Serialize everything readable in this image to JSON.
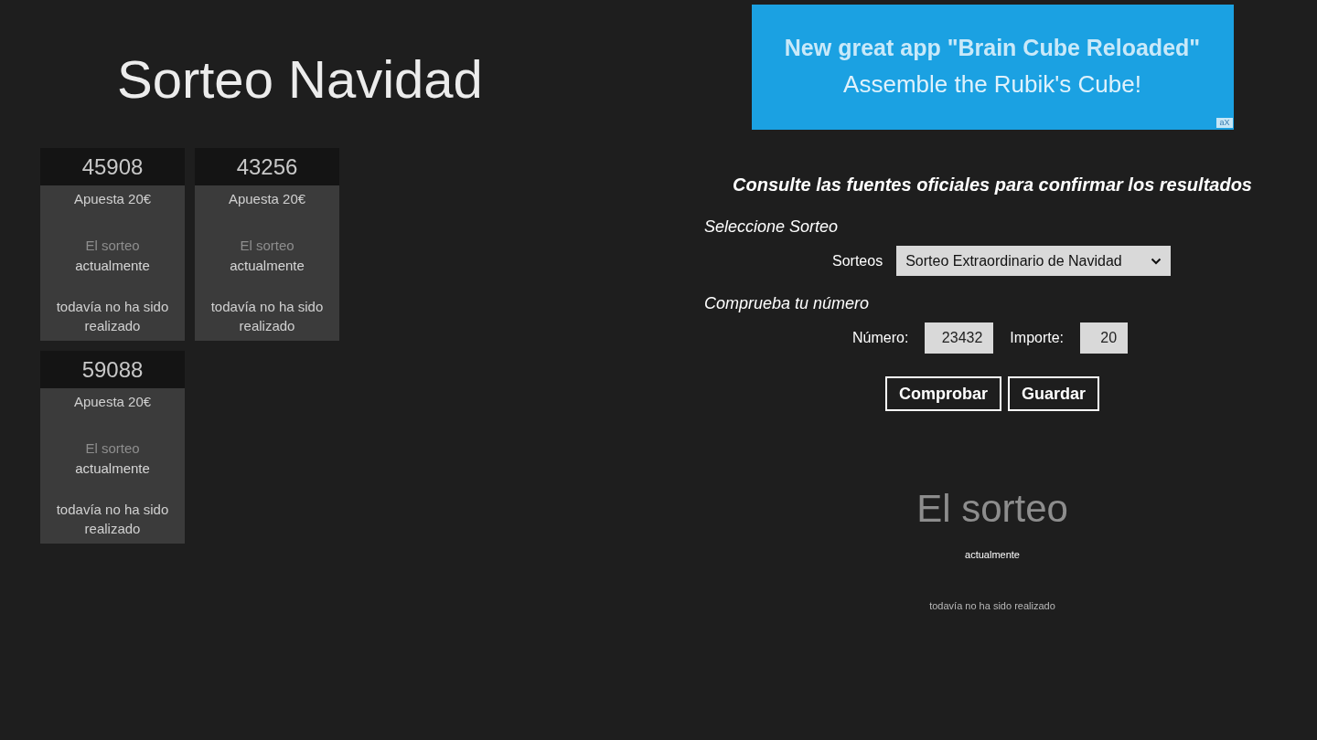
{
  "title": "Sorteo Navidad",
  "tickets": [
    {
      "number": "45908",
      "bet": "Apuesta 20€",
      "status": {
        "heading": "El sorteo",
        "detail": "actualmente",
        "note": "todavía no ha sido realizado"
      }
    },
    {
      "number": "43256",
      "bet": "Apuesta 20€",
      "status": {
        "heading": "El sorteo",
        "detail": "actualmente",
        "note": "todavía no ha sido realizado"
      }
    },
    {
      "number": "59088",
      "bet": "Apuesta 20€",
      "status": {
        "heading": "El sorteo",
        "detail": "actualmente",
        "note": "todavía no ha sido realizado"
      }
    }
  ],
  "ad": {
    "headline": "New great app \"Brain Cube Reloaded\"",
    "tagline": "Assemble the Rubik's Cube!",
    "mark": "aX"
  },
  "check_form": {
    "notice": "Consulte las fuentes oficiales para confirmar los resultados",
    "draw_section": {
      "title": "Seleccione Sorteo",
      "select_label": "Sorteos",
      "select_value": "Sorteo Extraordinario de Navidad"
    },
    "number_section": {
      "title": "Comprueba tu número",
      "fields": [
        {
          "label": "Número:",
          "value": "23432"
        },
        {
          "label": "Importe:",
          "value": "20"
        }
      ]
    },
    "buttons": [
      "Comprobar",
      "Guardar"
    ]
  },
  "result": {
    "heading": "El sorteo",
    "detail": "actualmente",
    "note": "todavía no ha sido realizado"
  }
}
